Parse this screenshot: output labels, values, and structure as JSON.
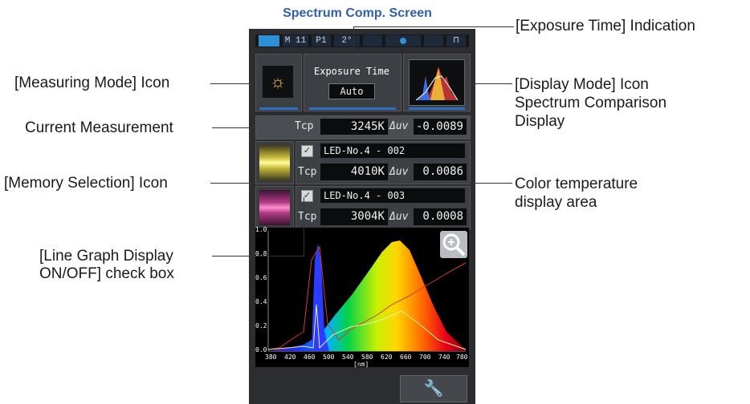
{
  "title": "Spectrum Comp. Screen",
  "callouts": {
    "exposure_time": "[Exposure Time] Indication",
    "measuring_mode": "[Measuring Mode] Icon",
    "display_mode_1": "[Display Mode] Icon",
    "display_mode_2": "Spectrum Comparison",
    "display_mode_3": "Display",
    "current_measurement": "Current Measurement",
    "memory_selection": "[Memory Selection] Icon",
    "color_temp_1": "Color temperature",
    "color_temp_2": "display area",
    "line_graph_1": "[Line Graph Display",
    "line_graph_2": "ON/OFF] check box"
  },
  "statusbar": {
    "mode": "M 11",
    "preset": "P1",
    "angle": "2°"
  },
  "exposure": {
    "label": "Exposure Time",
    "value": "Auto"
  },
  "current": {
    "tcp_label": "Tcp",
    "tcp_value": "3245K",
    "duv_label": "Δuv",
    "duv_value": "-0.0089"
  },
  "memory": [
    {
      "name": "LED-No.4 - 002",
      "tcp_label": "Tcp",
      "tcp_value": "4010K",
      "duv_label": "Δuv",
      "duv_value": "0.0086",
      "checked": "✓"
    },
    {
      "name": "LED-No.4 - 003",
      "tcp_label": "Tcp",
      "tcp_value": "3004K",
      "duv_label": "Δuv",
      "duv_value": "0.0008",
      "checked": "✓"
    }
  ],
  "graph": {
    "y_ticks": [
      "1.0",
      "0.8",
      "0.6",
      "0.4",
      "0.2",
      "0.0"
    ],
    "x_ticks": [
      "380",
      "420",
      "460",
      "500",
      "540",
      "580",
      "620",
      "660",
      "700",
      "740",
      "780"
    ],
    "x_unit": "[nm]"
  },
  "icons": {
    "measuring_mode": "sun-icon",
    "zoom": "zoom-in-icon",
    "tools": "wrench-icon"
  }
}
